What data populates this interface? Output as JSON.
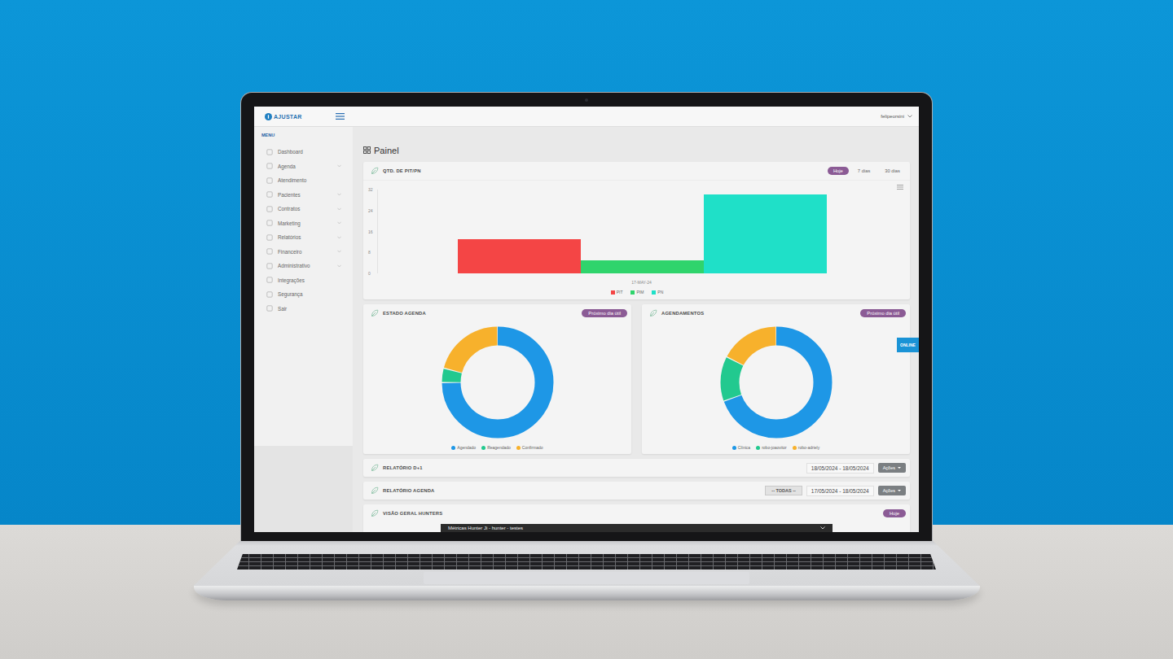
{
  "app": {
    "logo": "AJUSTAR",
    "user": "felipeorsini"
  },
  "sidebar": {
    "heading": "MENU",
    "items": [
      {
        "label": "Dashboard",
        "has_submenu": false
      },
      {
        "label": "Agenda",
        "has_submenu": true
      },
      {
        "label": "Atendimento",
        "has_submenu": false
      },
      {
        "label": "Pacientes",
        "has_submenu": true
      },
      {
        "label": "Contratos",
        "has_submenu": true
      },
      {
        "label": "Marketing",
        "has_submenu": true
      },
      {
        "label": "Relatórios",
        "has_submenu": true
      },
      {
        "label": "Financeiro",
        "has_submenu": true
      },
      {
        "label": "Administrativo",
        "has_submenu": true
      },
      {
        "label": "Integrações",
        "has_submenu": false
      },
      {
        "label": "Segurança",
        "has_submenu": false
      },
      {
        "label": "Sair",
        "has_submenu": false
      }
    ]
  },
  "page_title": "Painel",
  "pit_chart": {
    "title": "QTD. DE PIT/PN",
    "ranges": [
      {
        "label": "Hoje",
        "selected": true
      },
      {
        "label": "7 dias",
        "selected": false
      },
      {
        "label": "30 dias",
        "selected": false
      }
    ],
    "y_ticks": [
      "32",
      "24",
      "16",
      "8",
      "0"
    ],
    "categories": [
      "17-MAY-24"
    ],
    "series": [
      {
        "name": "PIT",
        "color": "#f44545",
        "values": [
          13
        ]
      },
      {
        "name": "PIM",
        "color": "#2fd46c",
        "values": [
          5
        ]
      },
      {
        "name": "PN",
        "color": "#1fe0c8",
        "values": [
          30
        ]
      }
    ]
  },
  "donuts": [
    {
      "title": "ESTADO AGENDA",
      "button": "Próximo dia útil",
      "slices": [
        {
          "label": "Agendado",
          "value": 18,
          "color": "#1e97e6"
        },
        {
          "label": "Reagendado",
          "value": 1,
          "color": "#22c98f"
        },
        {
          "label": "Confirmado",
          "value": 5,
          "color": "#f7b12c"
        }
      ]
    },
    {
      "title": "AGENDAMENTOS",
      "button": "Próximo dia útil",
      "slices": [
        {
          "label": "Clínica",
          "value": 16,
          "color": "#1e97e6"
        },
        {
          "label": "robo-joaovitor",
          "value": 3,
          "color": "#22c98f"
        },
        {
          "label": "robo-adriely",
          "value": 4,
          "color": "#f7b12c"
        }
      ]
    }
  ],
  "reports": [
    {
      "title": "RELATÓRIO D+1",
      "date_range": "18/05/2024 - 18/05/2024",
      "actions": "Ações"
    },
    {
      "title": "RELATÓRIO AGENDA",
      "select": "-- TODAS --",
      "date_range": "17/05/2024 - 18/05/2024",
      "actions": "Ações"
    }
  ],
  "hunters": {
    "title": "VISÃO GERAL HUNTERS",
    "range": "Hoje"
  },
  "online_tab": "ONLINE",
  "popup": {
    "title": "Métricas Hunter Ji - hunter - testes"
  }
}
